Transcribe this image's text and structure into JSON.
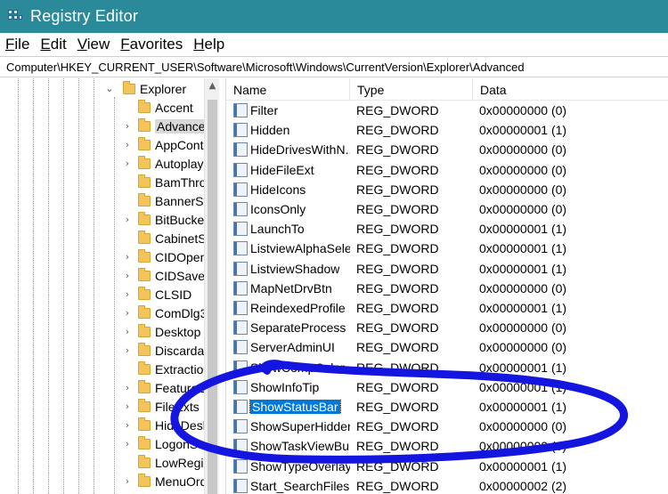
{
  "window": {
    "title": "Registry Editor"
  },
  "menu": [
    {
      "label": "File",
      "ul": "F",
      "rest": "ile"
    },
    {
      "label": "Edit",
      "ul": "E",
      "rest": "dit"
    },
    {
      "label": "View",
      "ul": "V",
      "rest": "iew"
    },
    {
      "label": "Favorites",
      "ul": "F",
      "rest": "avorites",
      "ul_index": 2
    },
    {
      "label": "Help",
      "ul": "H",
      "rest": "elp"
    }
  ],
  "address": {
    "path": "Computer\\HKEY_CURRENT_USER\\Software\\Microsoft\\Windows\\CurrentVersion\\Explorer\\Advanced"
  },
  "tree": {
    "parent": {
      "label": "Explorer",
      "expanded": true
    },
    "children": [
      {
        "label": "Accent",
        "has_children": false
      },
      {
        "label": "Advanced",
        "has_children": true,
        "selected": true
      },
      {
        "label": "AppCont",
        "has_children": true
      },
      {
        "label": "Autoplay",
        "has_children": true
      },
      {
        "label": "BamThro",
        "has_children": false
      },
      {
        "label": "BannerSt",
        "has_children": false
      },
      {
        "label": "BitBucket",
        "has_children": true
      },
      {
        "label": "CabinetS",
        "has_children": false
      },
      {
        "label": "CIDOpen",
        "has_children": true
      },
      {
        "label": "CIDSave",
        "has_children": true
      },
      {
        "label": "CLSID",
        "has_children": true
      },
      {
        "label": "ComDlg3",
        "has_children": true
      },
      {
        "label": "Desktop",
        "has_children": true
      },
      {
        "label": "Discardab",
        "has_children": true
      },
      {
        "label": "Extractio",
        "has_children": false
      },
      {
        "label": "FeatureU",
        "has_children": true
      },
      {
        "label": "FileExts",
        "has_children": true
      },
      {
        "label": "HideDesk",
        "has_children": true
      },
      {
        "label": "LogonSta",
        "has_children": true
      },
      {
        "label": "LowRegis",
        "has_children": false
      },
      {
        "label": "MenuOrd",
        "has_children": true
      }
    ]
  },
  "list": {
    "columns": {
      "name": "Name",
      "type": "Type",
      "data": "Data"
    },
    "rows": [
      {
        "name": "Filter",
        "type": "REG_DWORD",
        "data": "0x00000000 (0)"
      },
      {
        "name": "Hidden",
        "type": "REG_DWORD",
        "data": "0x00000001 (1)"
      },
      {
        "name": "HideDrivesWithN...",
        "type": "REG_DWORD",
        "data": "0x00000000 (0)"
      },
      {
        "name": "HideFileExt",
        "type": "REG_DWORD",
        "data": "0x00000000 (0)"
      },
      {
        "name": "HideIcons",
        "type": "REG_DWORD",
        "data": "0x00000000 (0)"
      },
      {
        "name": "IconsOnly",
        "type": "REG_DWORD",
        "data": "0x00000000 (0)"
      },
      {
        "name": "LaunchTo",
        "type": "REG_DWORD",
        "data": "0x00000001 (1)"
      },
      {
        "name": "ListviewAlphaSele...",
        "type": "REG_DWORD",
        "data": "0x00000001 (1)"
      },
      {
        "name": "ListviewShadow",
        "type": "REG_DWORD",
        "data": "0x00000001 (1)"
      },
      {
        "name": "MapNetDrvBtn",
        "type": "REG_DWORD",
        "data": "0x00000000 (0)"
      },
      {
        "name": "ReindexedProfile",
        "type": "REG_DWORD",
        "data": "0x00000001 (1)"
      },
      {
        "name": "SeparateProcess",
        "type": "REG_DWORD",
        "data": "0x00000000 (0)"
      },
      {
        "name": "ServerAdminUI",
        "type": "REG_DWORD",
        "data": "0x00000000 (0)"
      },
      {
        "name": "ShowCompColor",
        "type": "REG_DWORD",
        "data": "0x00000001 (1)"
      },
      {
        "name": "ShowInfoTip",
        "type": "REG_DWORD",
        "data": "0x00000001 (1)"
      },
      {
        "name": "ShowStatusBar",
        "type": "REG_DWORD",
        "data": "0x00000001 (1)",
        "selected": true
      },
      {
        "name": "ShowSuperHidden",
        "type": "REG_DWORD",
        "data": "0x00000000 (0)"
      },
      {
        "name": "ShowTaskViewBu...",
        "type": "REG_DWORD",
        "data": "0x00000000 (0)"
      },
      {
        "name": "ShowTypeOverlay",
        "type": "REG_DWORD",
        "data": "0x00000001 (1)"
      },
      {
        "name": "Start_SearchFiles",
        "type": "REG_DWORD",
        "data": "0x00000002 (2)"
      }
    ]
  },
  "colors": {
    "titlebar": "#2a8a9a",
    "selection": "#0078d7",
    "annotation": "#1515e0",
    "folder": "#f2c45a"
  }
}
